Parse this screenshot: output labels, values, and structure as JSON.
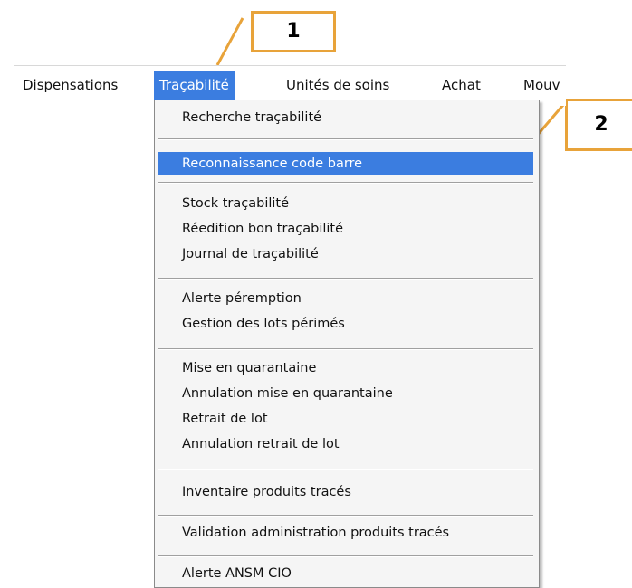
{
  "menubar": {
    "items": [
      {
        "label": "Dispensations"
      },
      {
        "label": "Traçabilité"
      },
      {
        "label": "Unités de soins"
      },
      {
        "label": "Achat"
      },
      {
        "label": "Mouv"
      }
    ]
  },
  "dropdown": {
    "items": [
      {
        "label": "Recherche traçabilité"
      },
      {
        "label": "Reconnaissance code barre"
      },
      {
        "label": "Stock traçabilité"
      },
      {
        "label": "Réedition bon traçabilité"
      },
      {
        "label": "Journal de traçabilité"
      },
      {
        "label": "Alerte péremption"
      },
      {
        "label": "Gestion des lots périmés"
      },
      {
        "label": "Mise en quarantaine"
      },
      {
        "label": "Annulation mise en quarantaine"
      },
      {
        "label": "Retrait de lot"
      },
      {
        "label": "Annulation retrait de lot"
      },
      {
        "label": "Inventaire produits tracés"
      },
      {
        "label": "Validation administration produits tracés"
      },
      {
        "label": "Alerte ANSM CIO"
      }
    ]
  },
  "callouts": [
    {
      "label": "1"
    },
    {
      "label": "2"
    }
  ],
  "colors": {
    "highlight": "#3b7de0",
    "callout_border": "#e8a33a"
  }
}
